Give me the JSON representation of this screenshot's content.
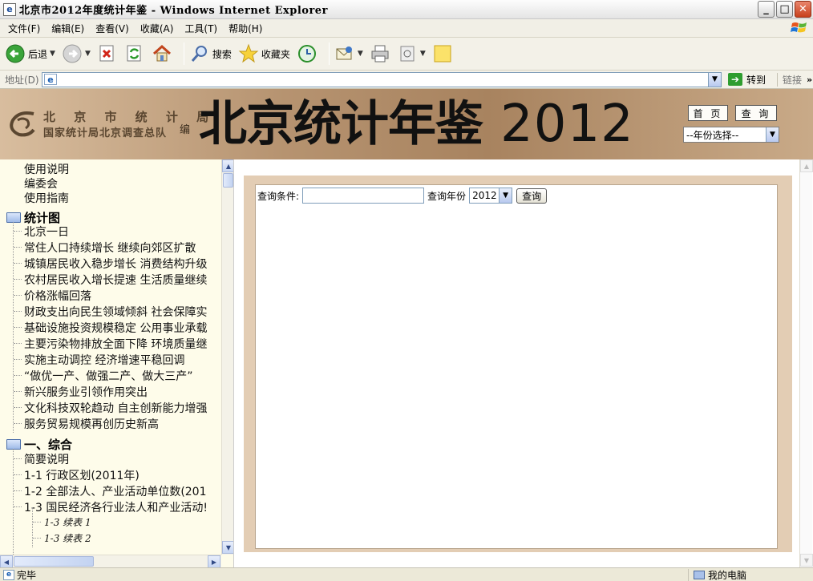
{
  "window": {
    "title": "北京市2012年度统计年鉴 - Windows Internet Explorer",
    "app_icon": "ie-page-icon"
  },
  "menubar": {
    "items": [
      "文件(F)",
      "编辑(E)",
      "查看(V)",
      "收藏(A)",
      "工具(T)",
      "帮助(H)"
    ]
  },
  "toolbar": {
    "back_label": "后退",
    "search_label": "搜索",
    "favorites_label": "收藏夹"
  },
  "addressbar": {
    "label": "地址(D)",
    "value": "",
    "go_label": "转到",
    "links_label": "链接",
    "more": "»"
  },
  "banner": {
    "org_name": "北 京 市 统 计 局",
    "org_name2": "国家统计局北京调查总队",
    "edit_char": "编",
    "title_cn": "北京统计年鉴",
    "title_year": "2012",
    "home_button": "首 页",
    "query_button": "查 询",
    "year_select_value": "--年份选择--"
  },
  "tree": {
    "top_items": [
      "使用说明",
      "编委会",
      "使用指南"
    ],
    "folder1": {
      "label": "统计图",
      "items": [
        "北京一日",
        "常住人口持续增长 继续向郊区扩散",
        "城镇居民收入稳步增长 消费结构升级",
        "农村居民收入增长提速 生活质量继续",
        "价格涨幅回落",
        "财政支出向民生领域倾斜 社会保障实",
        "基础设施投资规模稳定 公用事业承载",
        "主要污染物排放全面下降 环境质量继",
        "实施主动调控 经济增速平稳回调",
        "“做优一产、做强二产、做大三产”",
        "新兴服务业引领作用突出",
        "文化科技双轮趋动 自主创新能力增强",
        "服务贸易规模再创历史新高"
      ]
    },
    "folder2": {
      "label": "一、综合",
      "items": [
        "简要说明",
        "1-1 行政区划(2011年)",
        "1-2 全部法人、产业活动单位数(201",
        "1-3 国民经济各行业法人和产业活动!"
      ],
      "subitems": [
        "1-3 续表 1",
        "1-3 续表 2"
      ]
    }
  },
  "query": {
    "condition_label": "查询条件:",
    "condition_value": "",
    "year_label": "查询年份",
    "year_value": "2012",
    "button": "查询"
  },
  "statusbar": {
    "text": "完毕",
    "zone": "我的电脑"
  },
  "colors": {
    "tree_bg": "#fefcea",
    "panel_bg": "#e3cdb4",
    "banner_bg": "#b69370"
  }
}
